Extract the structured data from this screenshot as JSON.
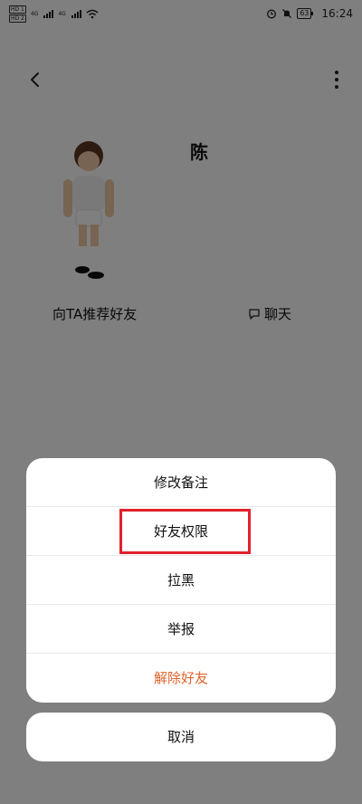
{
  "status_bar": {
    "sim1": "HD 1",
    "sim2": "HD 2",
    "net1": "4G",
    "net2": "4G",
    "battery": "63",
    "time": "16:24"
  },
  "header": {
    "back_icon": "chevron-left-icon",
    "more_icon": "more-vertical-icon"
  },
  "profile": {
    "name": "陈",
    "recommend_label": "向TA推荐好友",
    "chat_label": "聊天",
    "chat_icon": "chat-bubble-icon"
  },
  "action_sheet": {
    "items": [
      {
        "label": "修改备注"
      },
      {
        "label": "好友权限"
      },
      {
        "label": "拉黑"
      },
      {
        "label": "举报"
      },
      {
        "label": "解除好友"
      }
    ],
    "cancel_label": "取消",
    "danger_color": "#e0632b",
    "highlight_color": "#e3202c"
  }
}
